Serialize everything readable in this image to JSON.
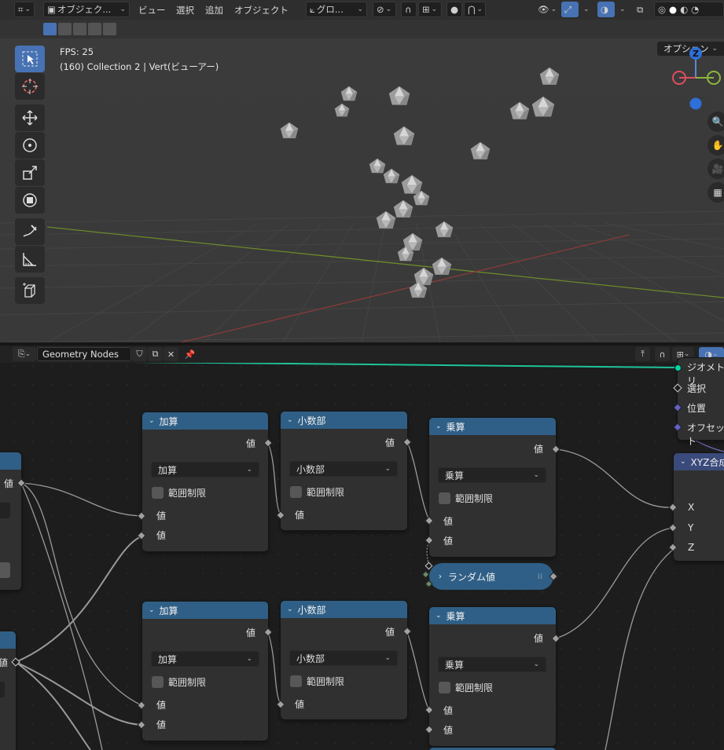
{
  "viewport_header": {
    "mode_label": "オブジェク...",
    "menus": [
      "ビュー",
      "選択",
      "追加",
      "オブジェクト"
    ],
    "transform_orientation": "グロ...",
    "options_label": "オプション"
  },
  "viewport": {
    "fps": "FPS: 25",
    "info": "(160) Collection 2 | Vert(ビューアー)",
    "gizmo": {
      "z": "Z"
    }
  },
  "node_editor": {
    "tree_name": "Geometry Nodes",
    "group_input": {
      "outputs": [
        "ジオメトリ",
        "選択",
        "位置",
        "オフセット"
      ]
    },
    "combine_node_title": "XYZ合成",
    "combine_inputs": [
      "X",
      "Y",
      "Z"
    ],
    "nodes_top": [
      {
        "title": "加算",
        "out": "値",
        "op": "加算",
        "clamp": "範囲制限",
        "in1": "値",
        "in2": "値"
      },
      {
        "title": "小数部",
        "out": "値",
        "op": "小数部",
        "clamp": "範囲制限",
        "in1": "値"
      },
      {
        "title": "乗算",
        "out": "値",
        "op": "乗算",
        "clamp": "範囲制限",
        "in1": "値",
        "in2": "値"
      }
    ],
    "nodes_bottom": [
      {
        "title": "加算",
        "out": "値",
        "op": "加算",
        "clamp": "範囲制限",
        "in1": "値",
        "in2": "値"
      },
      {
        "title": "小数部",
        "out": "値",
        "op": "小数部",
        "clamp": "範囲制限",
        "in1": "値"
      },
      {
        "title": "乗算",
        "out": "値",
        "op": "乗算",
        "clamp": "範囲制限",
        "in1": "値",
        "in2": "値"
      }
    ],
    "random_node": "ランダム値",
    "left_partial_labels": [
      "値",
      "値"
    ]
  },
  "colors": {
    "accent": "#4772b3",
    "node_header": "#2f5f86",
    "geometry_socket": "#00d6a3",
    "vector_socket": "#6363c7"
  }
}
